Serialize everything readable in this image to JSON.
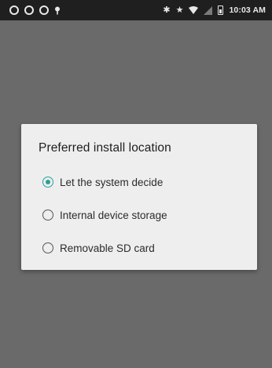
{
  "status_bar": {
    "left_icons": [
      "ring-icon",
      "ring-icon",
      "ring-icon",
      "location-pin-icon"
    ],
    "right_icons": [
      "bluetooth-icon",
      "star-icon",
      "wifi-icon",
      "signal-icon",
      "battery-icon"
    ],
    "time": "10:03 AM"
  },
  "dialog": {
    "title": "Preferred install location",
    "accent_color": "#2aa198",
    "options": [
      {
        "label": "Let the system decide",
        "selected": true
      },
      {
        "label": "Internal device storage",
        "selected": false
      },
      {
        "label": "Removable SD card",
        "selected": false
      }
    ]
  }
}
